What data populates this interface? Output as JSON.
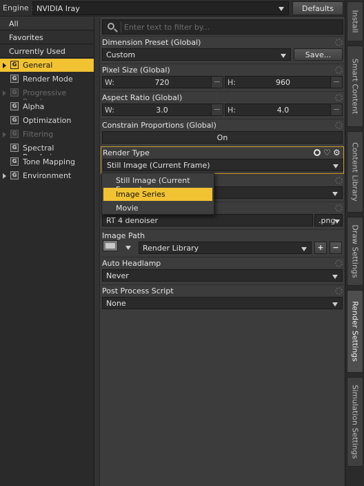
{
  "engine": {
    "label": "Engine :",
    "value": "NVIDIA Iray",
    "defaults_label": "Defaults"
  },
  "categories": [
    {
      "label": "All"
    },
    {
      "label": "Favorites"
    },
    {
      "label": "Currently Used"
    }
  ],
  "groups": [
    {
      "label": "General",
      "expandable": true,
      "active": true,
      "dim": false
    },
    {
      "label": "Render Mode",
      "expandable": false,
      "active": false,
      "dim": false
    },
    {
      "label": "Progressive Rend...",
      "expandable": true,
      "active": false,
      "dim": true
    },
    {
      "label": "Alpha",
      "expandable": false,
      "active": false,
      "dim": false
    },
    {
      "label": "Optimization",
      "expandable": false,
      "active": false,
      "dim": false
    },
    {
      "label": "Filtering",
      "expandable": true,
      "active": false,
      "dim": true
    },
    {
      "label": "Spectral Rendering",
      "expandable": false,
      "active": false,
      "dim": false
    },
    {
      "label": "Tone Mapping",
      "expandable": false,
      "active": false,
      "dim": false
    },
    {
      "label": "Environment",
      "expandable": true,
      "active": false,
      "dim": false
    }
  ],
  "filter": {
    "placeholder": "Enter text to filter by..."
  },
  "props": {
    "dimension_preset": {
      "label": "Dimension Preset (Global)",
      "value": "Custom",
      "save_label": "Save..."
    },
    "pixel_size": {
      "label": "Pixel Size (Global)",
      "w_key": "W:",
      "w": "720",
      "h_key": "H:",
      "h": "960"
    },
    "aspect_ratio": {
      "label": "Aspect Ratio (Global)",
      "w_key": "W:",
      "w": "3.0",
      "h_key": "H:",
      "h": "4.0"
    },
    "constrain": {
      "label": "Constrain Proportions (Global)",
      "value": "On"
    },
    "render_type": {
      "label": "Render Type",
      "value": "Still Image (Current Frame)"
    },
    "render_target": {
      "value": ""
    },
    "image_name": {
      "value": "RT 4 denoiser",
      "ext": ".png"
    },
    "image_path": {
      "label": "Image Path",
      "value": "Render Library"
    },
    "auto_headlamp": {
      "label": "Auto Headlamp",
      "value": "Never"
    },
    "post_process": {
      "label": "Post Process Script",
      "value": "None"
    }
  },
  "render_type_options": [
    {
      "label": "Still Image (Current Frame)",
      "selected": false
    },
    {
      "label": "Image Series",
      "selected": true
    },
    {
      "label": "Movie",
      "selected": false
    }
  ],
  "tabs": [
    {
      "label": "Install",
      "active": false
    },
    {
      "label": "Smart Content",
      "active": false
    },
    {
      "label": "Content Library",
      "active": false
    },
    {
      "label": "Draw Settings",
      "active": false
    },
    {
      "label": "Render Settings",
      "active": true
    },
    {
      "label": "Simulation Settings",
      "active": false
    }
  ],
  "colors": {
    "accent": "#f1c232",
    "panel": "#3c3c3c",
    "field": "#2a2a2a"
  }
}
